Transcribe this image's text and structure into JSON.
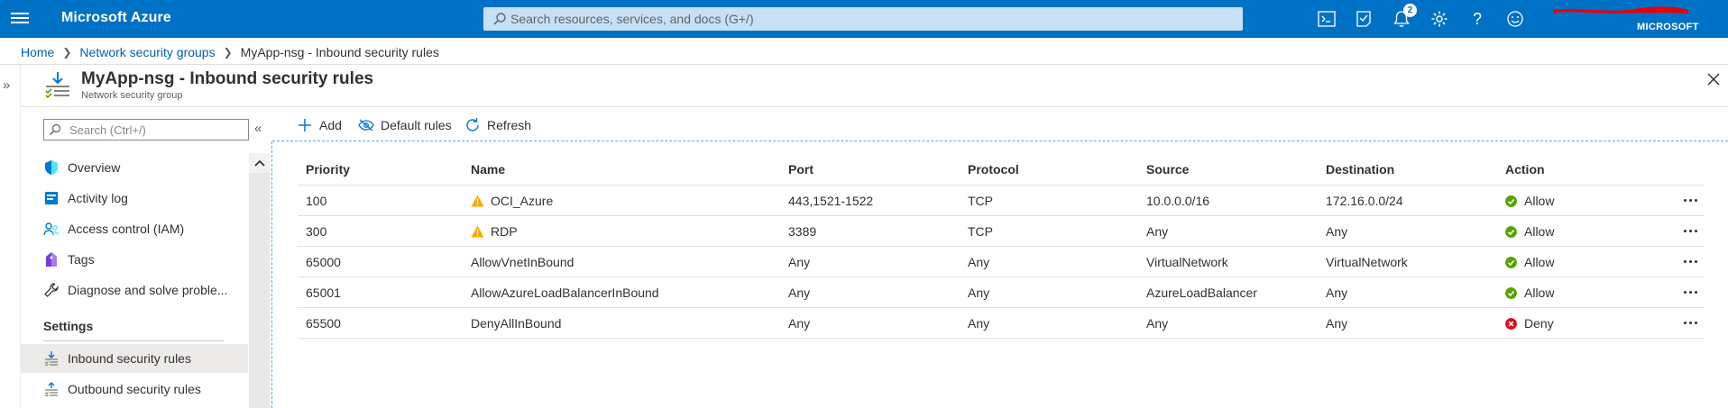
{
  "topbar": {
    "brand": "Microsoft Azure",
    "search_placeholder": "Search resources, services, and docs (G+/)",
    "notification_count": "2",
    "account_directory": "MICROSOFT",
    "accent_color": "#0072c6"
  },
  "breadcrumb": {
    "items": [
      "Home",
      "Network security groups"
    ],
    "current": "MyApp-nsg - Inbound security rules"
  },
  "blade": {
    "title": "MyApp-nsg - Inbound security rules",
    "subtitle": "Network security group"
  },
  "nav": {
    "search_placeholder": "Search (Ctrl+/)",
    "items": [
      {
        "label": "Overview",
        "icon": "shield-icon"
      },
      {
        "label": "Activity log",
        "icon": "activity-log-icon"
      },
      {
        "label": "Access control (IAM)",
        "icon": "people-icon"
      },
      {
        "label": "Tags",
        "icon": "tag-icon"
      },
      {
        "label": "Diagnose and solve proble...",
        "icon": "wrench-icon"
      }
    ],
    "section_settings": "Settings",
    "settings_items": [
      {
        "label": "Inbound security rules",
        "icon": "inbound-rules-icon",
        "active": true
      },
      {
        "label": "Outbound security rules",
        "icon": "outbound-rules-icon",
        "active": false
      }
    ]
  },
  "commands": {
    "add": "Add",
    "default_rules": "Default rules",
    "refresh": "Refresh"
  },
  "table": {
    "columns": [
      "Priority",
      "Name",
      "Port",
      "Protocol",
      "Source",
      "Destination",
      "Action"
    ],
    "rows": [
      {
        "priority": "100",
        "name": "OCI_Azure",
        "warning": true,
        "port": "443,1521-1522",
        "protocol": "TCP",
        "source": "10.0.0.0/16",
        "destination": "172.16.0.0/24",
        "action": "Allow"
      },
      {
        "priority": "300",
        "name": "RDP",
        "warning": true,
        "port": "3389",
        "protocol": "TCP",
        "source": "Any",
        "destination": "Any",
        "action": "Allow"
      },
      {
        "priority": "65000",
        "name": "AllowVnetInBound",
        "warning": false,
        "port": "Any",
        "protocol": "Any",
        "source": "VirtualNetwork",
        "destination": "VirtualNetwork",
        "action": "Allow"
      },
      {
        "priority": "65001",
        "name": "AllowAzureLoadBalancerInBound",
        "warning": false,
        "port": "Any",
        "protocol": "Any",
        "source": "AzureLoadBalancer",
        "destination": "Any",
        "action": "Allow"
      },
      {
        "priority": "65500",
        "name": "DenyAllInBound",
        "warning": false,
        "port": "Any",
        "protocol": "Any",
        "source": "Any",
        "destination": "Any",
        "action": "Deny"
      }
    ],
    "allow_color": "#57a300",
    "deny_color": "#e00b1c",
    "warning_color": "#f7a800"
  }
}
